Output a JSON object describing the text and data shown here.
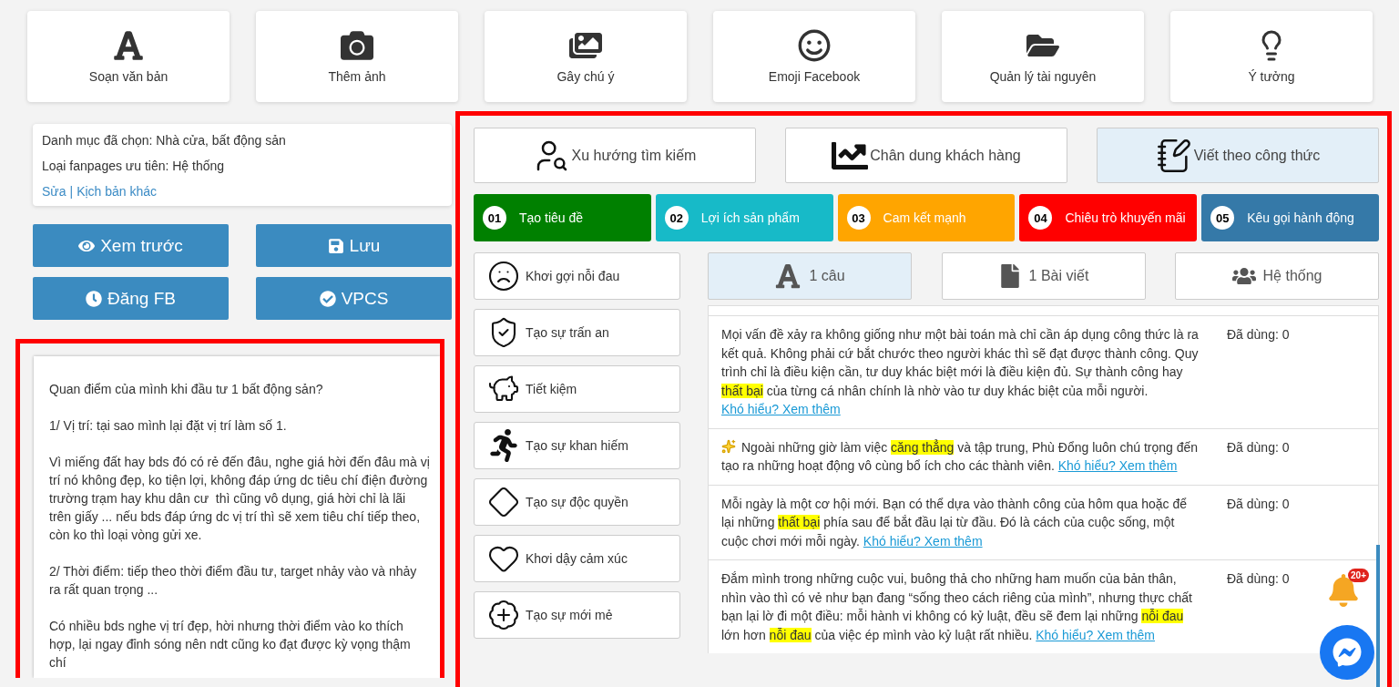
{
  "toolbar": [
    {
      "label": "Soạn văn bản"
    },
    {
      "label": "Thêm ảnh"
    },
    {
      "label": "Gây chú ý"
    },
    {
      "label": "Emoji Facebook"
    },
    {
      "label": "Quản lý tài nguyên"
    },
    {
      "label": "Ý tưởng"
    }
  ],
  "info": {
    "category": "Danh mục đã chọn: Nhà cửa, bất động sản",
    "fanpage": "Loại fanpages ưu tiên: Hệ thống",
    "links": [
      "Sửa",
      "Kịch bản khác"
    ],
    "separator": "|"
  },
  "actions": [
    {
      "label": "Xem trước"
    },
    {
      "label": "Lưu"
    },
    {
      "label": "Đăng FB"
    },
    {
      "label": "VPCS"
    }
  ],
  "draft": {
    "paragraphs": [
      "Quan điểm của mình khi đầu tư 1 bất động sản?",
      "1/ Vị trí: tại sao mình lại đặt vị trí làm số 1.",
      "Vì miếng đất hay bds đó có rẻ đến đâu, nghe giá hời đến đâu mà vị trí nó không đẹp, ko tiện lợi, không đáp ứng dc tiêu chí điện đường trường trạm hay khu dân cư  thì cũng vô dụng, giá hời chỉ là lãi trên giấy ... nếu bds đáp ứng dc vị trí thì sẽ xem tiêu chí tiếp theo, còn ko thì loại vòng gửi xe.",
      "2/ Thời điểm: tiếp theo thời điểm đầu tư, target nhảy vào và nhảy ra rất quan trọng ...",
      "Có nhiều bds nghe vị trí đẹp, hời nhưng thời điểm vào ko thích hợp, lại ngay đỉnh sóng nên ndt cũng ko đạt được kỳ vọng thậm chí"
    ]
  },
  "modes": [
    {
      "label": "Xu hướng tìm kiếm",
      "selected": false
    },
    {
      "label": "Chân dung khách hàng",
      "selected": false
    },
    {
      "label": "Viết theo công thức",
      "selected": true
    }
  ],
  "steps": [
    {
      "number": "01",
      "label": "Tạo tiêu đề",
      "color": "#008000"
    },
    {
      "number": "02",
      "label": "Lợi ích sản phẩm",
      "color": "#17bac8"
    },
    {
      "number": "03",
      "label": "Cam kết mạnh",
      "color": "#ffa500"
    },
    {
      "number": "04",
      "label": "Chiêu trò khuyến mãi",
      "color": "#ff0000"
    },
    {
      "number": "05",
      "label": "Kêu gọi hành động",
      "color": "#3579a8"
    }
  ],
  "strategies": [
    {
      "label": "Khơi gợi nỗi đau"
    },
    {
      "label": "Tạo sự trấn an"
    },
    {
      "label": "Tiết kiệm"
    },
    {
      "label": "Tạo sự khan hiếm"
    },
    {
      "label": "Tạo sự độc quyền"
    },
    {
      "label": "Khơi dậy cảm xúc"
    },
    {
      "label": "Tạo sự mới mẻ"
    }
  ],
  "formats": [
    {
      "label": "1 câu",
      "selected": true
    },
    {
      "label": "1 Bài viết",
      "selected": false
    },
    {
      "label": "Hệ thống",
      "selected": false
    }
  ],
  "suggestions": [
    {
      "sparkle": false,
      "segments": [
        {
          "text": "Mọi vấn đề xảy ra không giống như một bài toán mà chỉ cần áp dụng công thức là ra kết quả. Không phải cứ bắt chước theo người khác thì sẽ đạt được thành công. Quy trình chỉ là điều kiện cần, tư duy khác biệt mới là điều kiện đủ. Sự thành công hay ",
          "highlight": false
        },
        {
          "text": "thất bại",
          "highlight": true
        },
        {
          "text": " của từng cá nhân chính là nhờ vào tư duy khác biệt của mỗi người.",
          "highlight": false
        }
      ],
      "link": "Khó hiểu? Xem thêm",
      "used": "Đã dùng: 0"
    },
    {
      "sparkle": true,
      "segments": [
        {
          "text": "Ngoài những giờ làm việc ",
          "highlight": false
        },
        {
          "text": "căng thẳng",
          "highlight": true
        },
        {
          "text": " và tập trung, Phù Đổng luôn chú trọng đến tạo ra những hoạt động vô cùng bổ ích cho các thành viên.",
          "highlight": false
        }
      ],
      "link": "Khó hiểu? Xem thêm",
      "used": "Đã dùng: 0"
    },
    {
      "sparkle": false,
      "segments": [
        {
          "text": "Mỗi ngày là một cơ hội mới. Bạn có thể dựa vào thành công của hôm qua hoặc để lại những ",
          "highlight": false
        },
        {
          "text": "thất bại",
          "highlight": true
        },
        {
          "text": " phía sau để bắt đầu lại từ đầu. Đó là cách của cuộc sống, một cuộc chơi mới mỗi ngày.",
          "highlight": false
        }
      ],
      "link": "Khó hiểu? Xem thêm",
      "used": "Đã dùng: 0"
    },
    {
      "sparkle": false,
      "segments": [
        {
          "text": "Đắm mình trong những cuộc vui, buông thả cho những ham muốn của bản thân, nhìn vào thì có vẻ như bạn đang “sống theo cách riêng của mình”, nhưng thực chất bạn lại lờ đi một điều: mỗi hành vi không có kỷ luật, đều sẽ đem lại những ",
          "highlight": false
        },
        {
          "text": "nỗi đau",
          "highlight": true
        },
        {
          "text": " lớn hơn ",
          "highlight": false
        },
        {
          "text": "nỗi đau",
          "highlight": true
        },
        {
          "text": " của việc ép mình vào kỷ luật rất nhiều.",
          "highlight": false
        }
      ],
      "link": "Khó hiểu? Xem thêm",
      "used": "Đã dùng: 0"
    }
  ],
  "notifications": {
    "badge": "20+"
  }
}
